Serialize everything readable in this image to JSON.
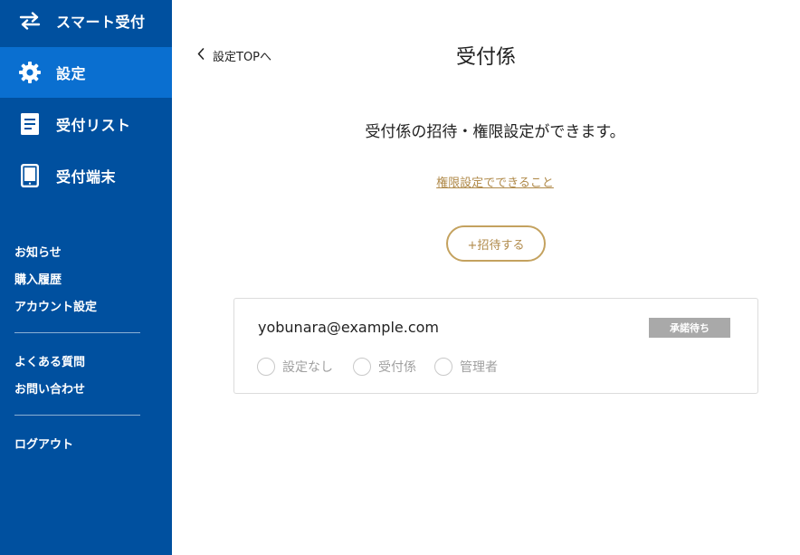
{
  "sidebar": {
    "nav": [
      {
        "label": "スマート受付",
        "icon": "swap-arrows-icon",
        "active": false
      },
      {
        "label": "設定",
        "icon": "gear-icon",
        "active": true
      },
      {
        "label": "受付リスト",
        "icon": "document-list-icon",
        "active": false
      },
      {
        "label": "受付端末",
        "icon": "tablet-icon",
        "active": false
      }
    ],
    "links_group1": [
      "お知らせ",
      "購入履歴",
      "アカウント設定"
    ],
    "links_group2": [
      "よくある質問",
      "お問い合わせ"
    ],
    "logout": "ログアウト"
  },
  "main": {
    "back_label": "設定TOPへ",
    "title": "受付係",
    "description": "受付係の招待・権限設定ができます。",
    "help_link": "権限設定でできること",
    "invite_button": "+招待する",
    "members": [
      {
        "email": "yobunara@example.com",
        "status": "承諾待ち",
        "roles": [
          "設定なし",
          "受付係",
          "管理者"
        ]
      }
    ]
  },
  "colors": {
    "sidebar_bg": "#00509f",
    "sidebar_active": "#0a6fd0",
    "accent_gold": "#b08a4a",
    "badge_gray": "#a9a9a9"
  }
}
